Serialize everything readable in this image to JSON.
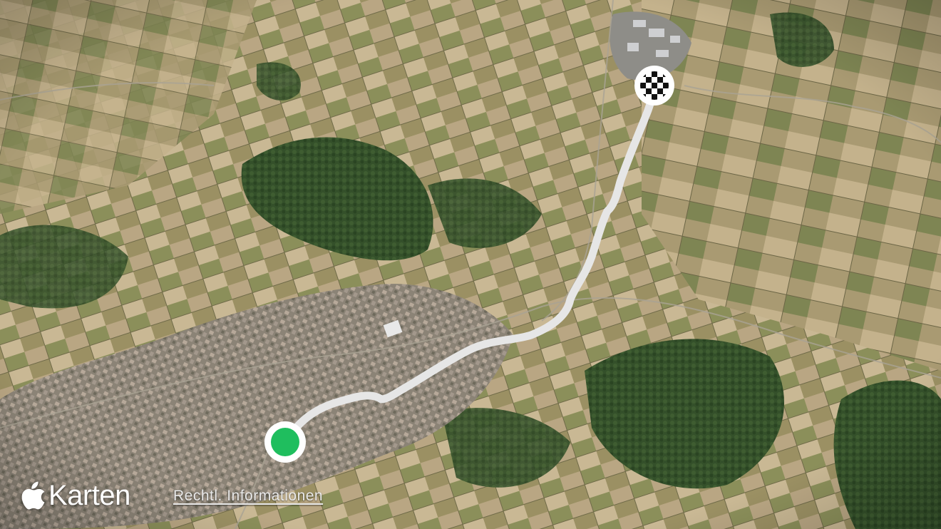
{
  "map": {
    "type": "satellite",
    "route_color": "#e6e6e6",
    "start_marker_color": "#1fbe5e",
    "end_marker_style": "checkered-flag",
    "land_palette": [
      "#7f7e5a",
      "#9b9063",
      "#b9a683",
      "#c9b894",
      "#2f4a25",
      "#4b6634",
      "#8b8f5a"
    ],
    "urban_color": "#8b8376"
  },
  "branding": {
    "logo_icon": "apple-logo-icon",
    "app_name": "Karten"
  },
  "footer": {
    "legal_link": "Rechtl. Informationen"
  }
}
